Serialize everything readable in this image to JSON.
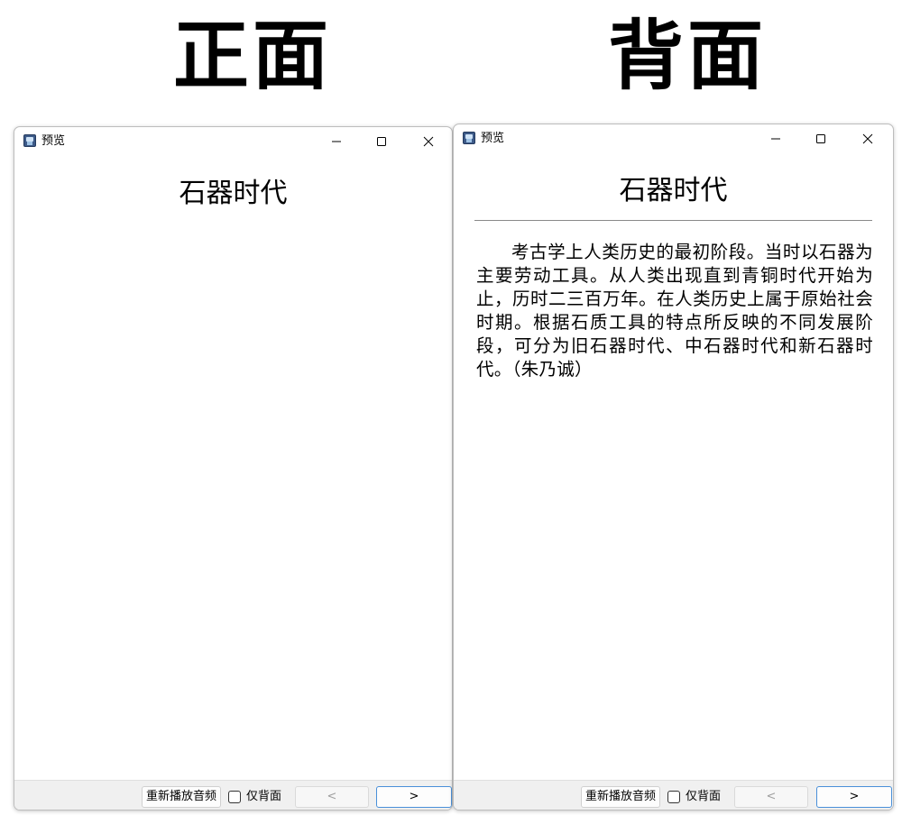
{
  "labels": {
    "front": "正面",
    "back": "背面"
  },
  "windows": [
    {
      "title": "预览",
      "card_title": "石器时代",
      "controls": {
        "replay_label": "重新播放音频",
        "back_only_label": "仅背面",
        "prev_symbol": "<",
        "next_symbol": ">"
      }
    },
    {
      "title": "预览",
      "card_title": "石器时代",
      "card_body": "考古学上人类历史的最初阶段。当时以石器为主要劳动工具。从人类出现直到青铜时代开始为止，历时二三百万年。在人类历史上属于原始社会时期。根据石质工具的特点所反映的不同发展阶段，可分为旧石器时代、中石器时代和新石器时代。（朱乃诚）",
      "controls": {
        "replay_label": "重新播放音频",
        "back_only_label": "仅背面",
        "prev_symbol": "<",
        "next_symbol": ">"
      }
    }
  ],
  "colors": {
    "next_button_border": "#4a90d9",
    "bottom_bar": "#f0f0f0"
  }
}
